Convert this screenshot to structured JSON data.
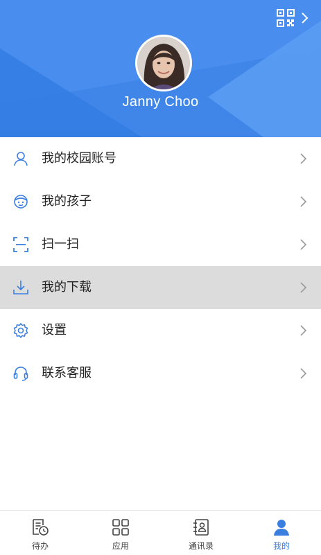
{
  "profile": {
    "name": "Janny Choo"
  },
  "menu": {
    "items": [
      {
        "label": "我的校园账号",
        "icon": "user-icon"
      },
      {
        "label": "我的孩子",
        "icon": "child-face-icon"
      },
      {
        "label": "扫一扫",
        "icon": "scan-icon"
      },
      {
        "label": "我的下载",
        "icon": "download-icon",
        "highlighted": true
      },
      {
        "label": "设置",
        "icon": "gear-icon"
      },
      {
        "label": "联系客服",
        "icon": "headset-icon"
      }
    ]
  },
  "tabbar": {
    "tabs": [
      {
        "label": "待办",
        "icon": "todo-clock-icon"
      },
      {
        "label": "应用",
        "icon": "apps-grid-icon"
      },
      {
        "label": "通讯录",
        "icon": "contacts-icon"
      },
      {
        "label": "我的",
        "icon": "profile-icon",
        "active": true
      }
    ]
  },
  "colors": {
    "header_blue": "#3f86e8",
    "accent": "#3a7fe0",
    "highlight_row": "#dcdcdc"
  }
}
